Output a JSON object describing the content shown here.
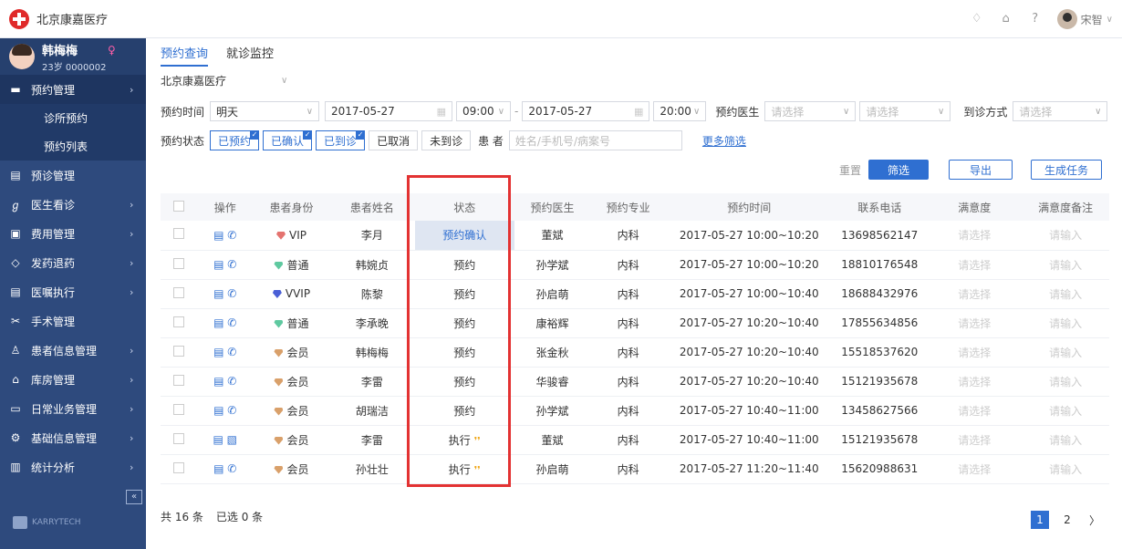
{
  "app": {
    "title": "北京康嘉医疗"
  },
  "user": {
    "name": "宋智"
  },
  "patient": {
    "name": "韩梅梅",
    "sub": "23岁 0000002"
  },
  "sidebar": {
    "items": [
      {
        "label": "预约管理",
        "icon": "calendar-icon"
      },
      {
        "label": "诊所预约"
      },
      {
        "label": "预约列表"
      },
      {
        "label": "预诊管理",
        "icon": "clipboard-icon"
      },
      {
        "label": "医生看诊",
        "icon": "stethoscope-icon"
      },
      {
        "label": "费用管理",
        "icon": "fee-icon"
      },
      {
        "label": "发药退药",
        "icon": "pill-icon"
      },
      {
        "label": "医嘱执行",
        "icon": "order-icon"
      },
      {
        "label": "手术管理",
        "icon": "scissors-icon"
      },
      {
        "label": "患者信息管理",
        "icon": "person-icon"
      },
      {
        "label": "库房管理",
        "icon": "warehouse-icon"
      },
      {
        "label": "日常业务管理",
        "icon": "folder-icon"
      },
      {
        "label": "基础信息管理",
        "icon": "gear-icon"
      },
      {
        "label": "统计分析",
        "icon": "chart-icon"
      }
    ],
    "brand": "KARRYTECH"
  },
  "tabs": [
    "预约查询",
    "就诊监控"
  ],
  "org": "北京康嘉医疗",
  "filters": {
    "time_label": "预约时间",
    "time_value": "明天",
    "date_from": "2017-05-27",
    "time_from": "09:00",
    "date_to": "2017-05-27",
    "time_to": "20:00",
    "doctor_label": "预约医生",
    "doctor_ph": "请选择",
    "doctor_ph2": "请选择",
    "visit_label": "到诊方式",
    "visit_ph": "请选择",
    "status_label": "预约状态",
    "status_chips": [
      "已预约",
      "已确认",
      "已到诊",
      "已取消",
      "未到诊"
    ],
    "patient_label": "患 者",
    "patient_ph": "姓名/手机号/病案号",
    "more": "更多筛选"
  },
  "actions": {
    "reset": "重置",
    "filter": "筛选",
    "export": "导出",
    "task": "生成任务"
  },
  "table": {
    "headers": [
      "操作",
      "患者身份",
      "患者姓名",
      "状态",
      "预约医生",
      "预约专业",
      "预约时间",
      "联系电话",
      "满意度",
      "满意度备注"
    ],
    "rows": [
      {
        "identity": "VIP",
        "gem": "#e4736f",
        "name": "李月",
        "status": "预约确认",
        "doctor": "董斌",
        "dept": "内科",
        "time": "2017-05-27 10:00~10:20",
        "phone": "13698562147",
        "sat": "请选择",
        "note": "请输入"
      },
      {
        "identity": "普通",
        "gem": "#5fc9a0",
        "name": "韩婉贞",
        "status": "预约",
        "doctor": "孙学斌",
        "dept": "内科",
        "time": "2017-05-27 10:00~10:20",
        "phone": "18810176548",
        "sat": "请选择",
        "note": "请输入"
      },
      {
        "identity": "VVIP",
        "gem": "#4a5fd6",
        "name": "陈黎",
        "status": "预约",
        "doctor": "孙启萌",
        "dept": "内科",
        "time": "2017-05-27 10:00~10:40",
        "phone": "18688432976",
        "sat": "请选择",
        "note": "请输入"
      },
      {
        "identity": "普通",
        "gem": "#5fc9a0",
        "name": "李承晚",
        "status": "预约",
        "doctor": "康裕辉",
        "dept": "内科",
        "time": "2017-05-27 10:20~10:40",
        "phone": "17855634856",
        "sat": "请选择",
        "note": "请输入"
      },
      {
        "identity": "会员",
        "gem": "#d9a06a",
        "name": "韩梅梅",
        "status": "预约",
        "doctor": "张金秋",
        "dept": "内科",
        "time": "2017-05-27 10:20~10:40",
        "phone": "15518537620",
        "sat": "请选择",
        "note": "请输入"
      },
      {
        "identity": "会员",
        "gem": "#d9a06a",
        "name": "李雷",
        "status": "预约",
        "doctor": "华骏睿",
        "dept": "内科",
        "time": "2017-05-27 10:20~10:40",
        "phone": "15121935678",
        "sat": "请选择",
        "note": "请输入"
      },
      {
        "identity": "会员",
        "gem": "#d9a06a",
        "name": "胡瑞洁",
        "status": "预约",
        "doctor": "孙学斌",
        "dept": "内科",
        "time": "2017-05-27 10:40~11:00",
        "phone": "13458627566",
        "sat": "请选择",
        "note": "请输入"
      },
      {
        "identity": "会员",
        "gem": "#d9a06a",
        "name": "李雷",
        "status": "执行",
        "doctor": "董斌",
        "dept": "内科",
        "time": "2017-05-27 10:40~11:00",
        "phone": "15121935678",
        "sat": "请选择",
        "note": "请输入"
      },
      {
        "identity": "会员",
        "gem": "#d9a06a",
        "name": "孙壮壮",
        "status": "执行",
        "doctor": "孙启萌",
        "dept": "内科",
        "time": "2017-05-27 11:20~11:40",
        "phone": "15620988631",
        "sat": "请选择",
        "note": "请输入"
      }
    ]
  },
  "footer": {
    "total": "共 16 条",
    "selected": "已选 0 条"
  },
  "pager": {
    "pages": [
      "1",
      "2"
    ],
    "next": "〉"
  }
}
